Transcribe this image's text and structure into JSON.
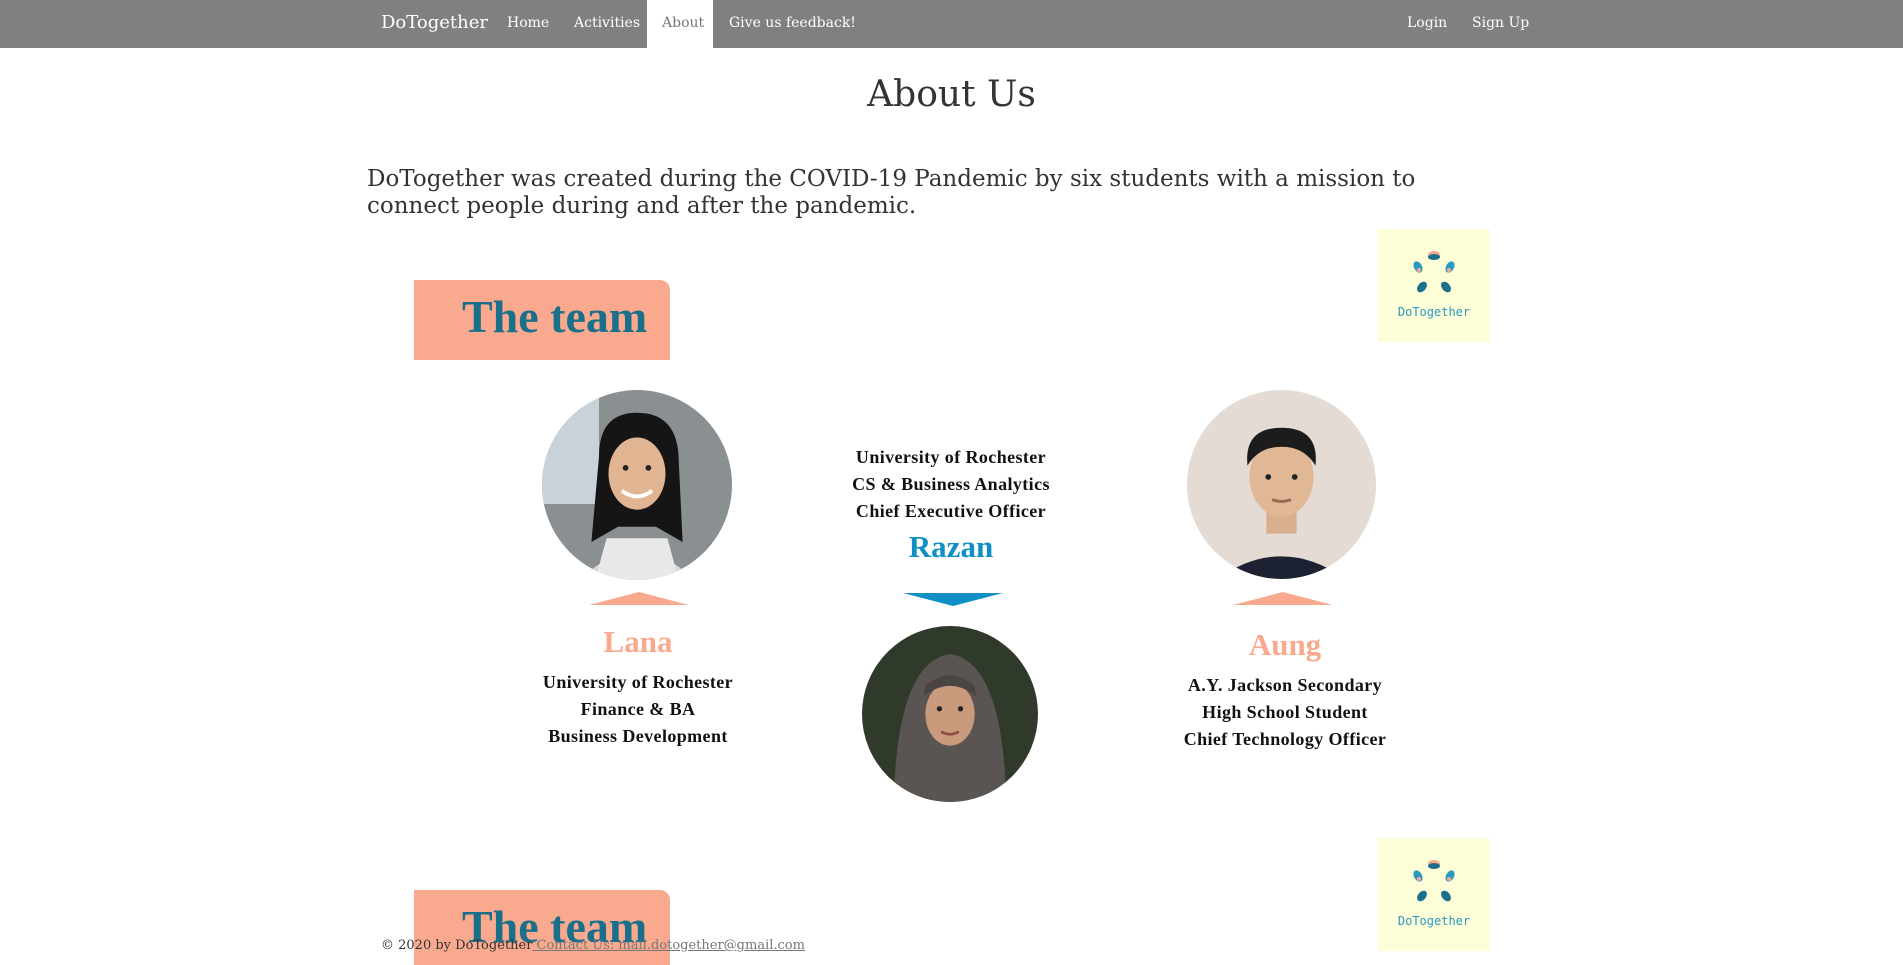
{
  "nav": {
    "brand": "DoTogether",
    "items": [
      {
        "label": "Home",
        "active": false
      },
      {
        "label": "Activities",
        "active": false
      },
      {
        "label": "About",
        "active": true
      },
      {
        "label": "Give us feedback!",
        "active": false
      }
    ],
    "login": "Login",
    "signup": "Sign Up"
  },
  "page": {
    "title": "About Us",
    "intro": "DoTogether was created during the COVID-19 Pandemic by six students with a mission to connect people during and after the pandemic."
  },
  "team": {
    "banner": "The team",
    "logo_text": "DoTogether",
    "members": [
      {
        "name": "Lana",
        "lines": [
          "University of Rochester",
          "Finance & BA",
          "Business Development"
        ]
      },
      {
        "name": "Razan",
        "lines": [
          "University of Rochester",
          "CS & Business Analytics",
          "Chief Executive Officer"
        ]
      },
      {
        "name": "Aung",
        "lines": [
          "A.Y. Jackson Secondary",
          "High School Student",
          "Chief Technology Officer"
        ]
      }
    ]
  },
  "footer": {
    "copyright": "© 2020 by DoTogether",
    "contact": " Contact Us: mail.dotogether@gmail.com"
  },
  "colors": {
    "navbar": "#808080",
    "salmon": "#f9a98d",
    "team_blue": "#1a6f8b",
    "accent_blue": "#0e8fc6",
    "logo_bg": "#fdfdd8"
  }
}
